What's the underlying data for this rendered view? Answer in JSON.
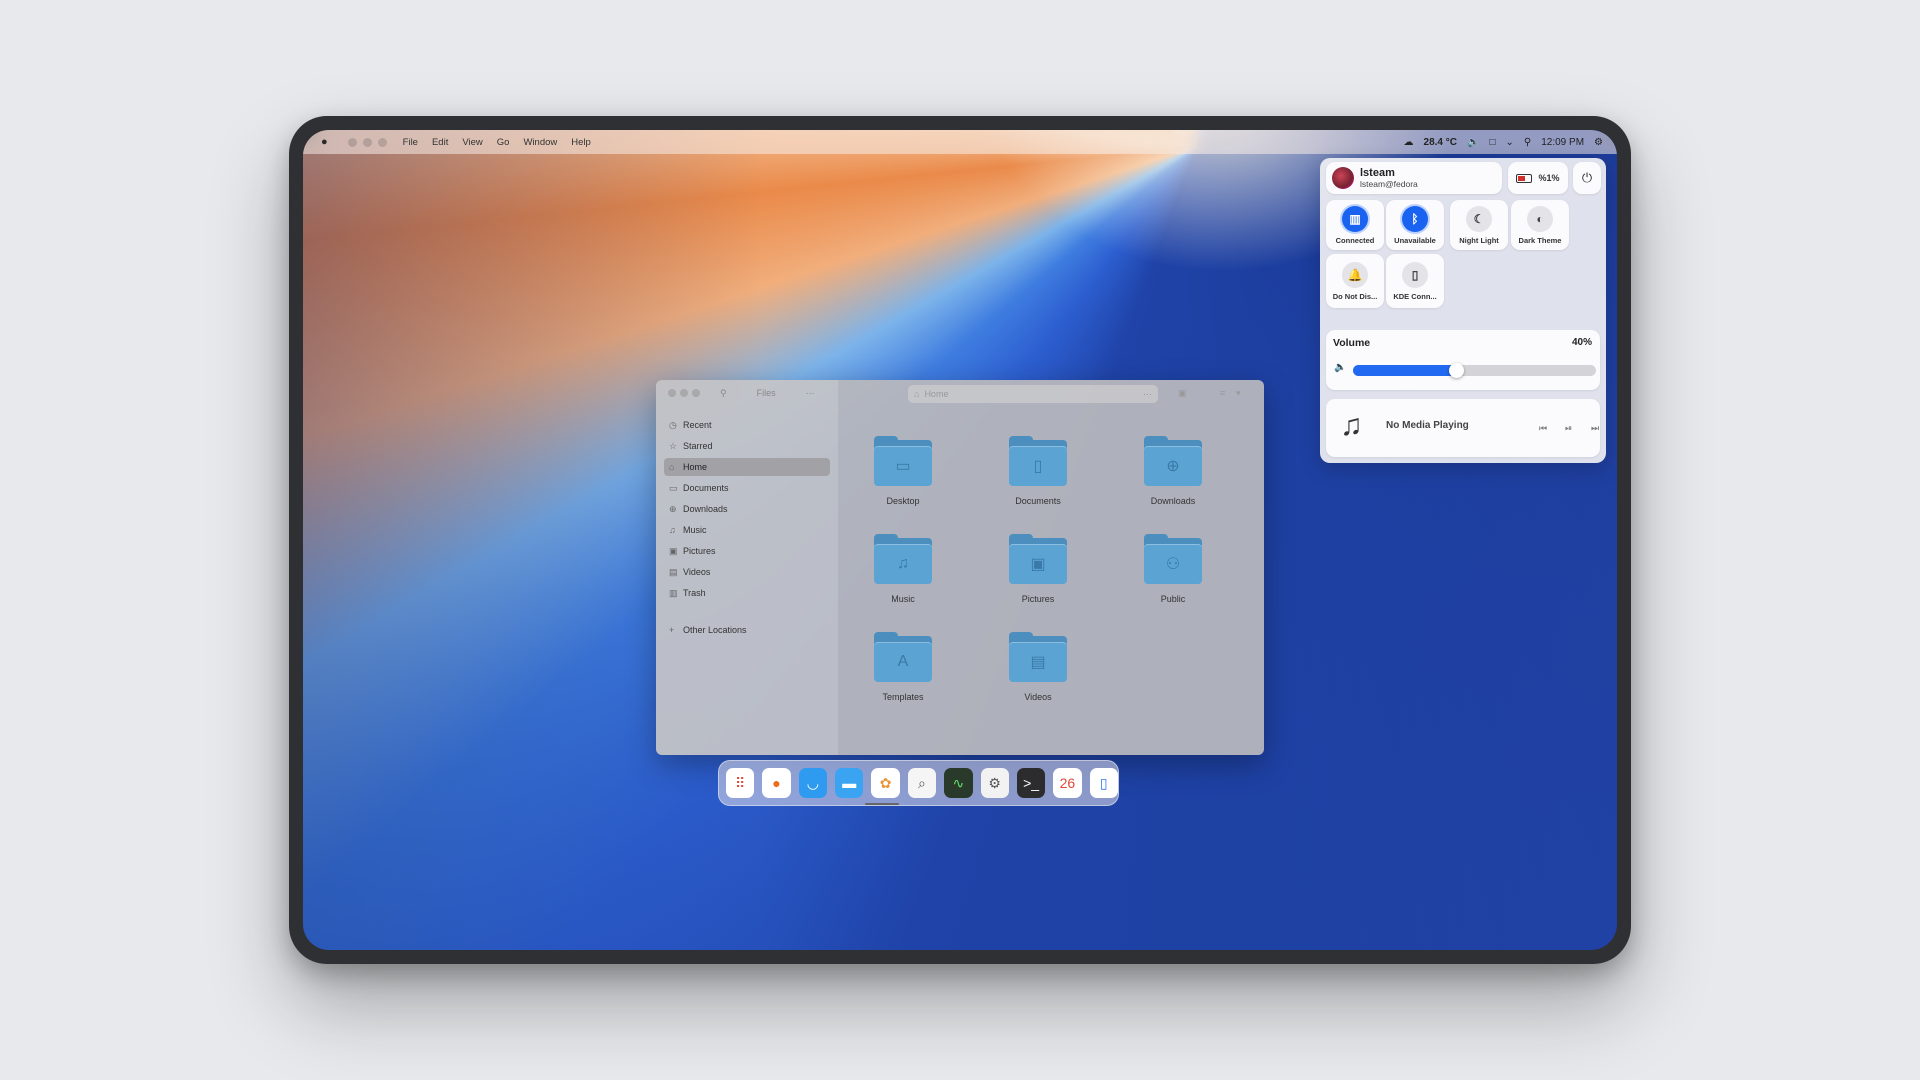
{
  "menubar": {
    "apple": "",
    "menus": [
      "File",
      "Edit",
      "View",
      "Go",
      "Window",
      "Help"
    ],
    "temperature": "28.4 °C",
    "time": "12:09 PM"
  },
  "control_center": {
    "user_name": "lsteam",
    "user_email": "lsteam@fedora",
    "battery": "%1%",
    "tiles": [
      {
        "label": "Connected",
        "icon": "network-icon",
        "glyph": "▥",
        "active": true
      },
      {
        "label": "Unavailable",
        "icon": "bluetooth-icon",
        "glyph": "ᛒ",
        "active": true
      },
      {
        "label": "Night Light",
        "icon": "night-light-icon",
        "glyph": "☾",
        "active": false
      },
      {
        "label": "Dark Theme",
        "icon": "dark-theme-icon",
        "glyph": "◐",
        "active": false
      },
      {
        "label": "Do Not Dis...",
        "icon": "bell-icon",
        "glyph": "🔔",
        "active": false
      },
      {
        "label": "KDE Conn...",
        "icon": "phone-icon",
        "glyph": "▯",
        "active": false
      }
    ],
    "volume": {
      "label": "Volume",
      "value_text": "40%",
      "level": 0.4
    },
    "media": {
      "text": "No Media Playing"
    }
  },
  "files": {
    "title": "Files",
    "path": "Home",
    "sidebar": [
      {
        "label": "Recent",
        "icon": "clock-icon",
        "glyph": "◷",
        "active": false
      },
      {
        "label": "Starred",
        "icon": "star-icon",
        "glyph": "☆",
        "active": false
      },
      {
        "label": "Home",
        "icon": "home-icon",
        "glyph": "⌂",
        "active": true
      },
      {
        "label": "Documents",
        "icon": "document-icon",
        "glyph": "▭",
        "active": false
      },
      {
        "label": "Downloads",
        "icon": "download-icon",
        "glyph": "⊕",
        "active": false
      },
      {
        "label": "Music",
        "icon": "music-icon",
        "glyph": "♫",
        "active": false
      },
      {
        "label": "Pictures",
        "icon": "picture-icon",
        "glyph": "▣",
        "active": false
      },
      {
        "label": "Videos",
        "icon": "video-icon",
        "glyph": "▤",
        "active": false
      },
      {
        "label": "Trash",
        "icon": "trash-icon",
        "glyph": "▥",
        "active": false
      }
    ],
    "other_locations": "Other Locations",
    "folders": [
      {
        "label": "Desktop",
        "glyph": "▭"
      },
      {
        "label": "Documents",
        "glyph": "▯"
      },
      {
        "label": "Downloads",
        "glyph": "⊕"
      },
      {
        "label": "Music",
        "glyph": "♫"
      },
      {
        "label": "Pictures",
        "glyph": "▣"
      },
      {
        "label": "Public",
        "glyph": "⚇"
      },
      {
        "label": "Templates",
        "glyph": "A"
      },
      {
        "label": "Videos",
        "glyph": "▤"
      }
    ]
  },
  "dock": {
    "apps": [
      {
        "name": "launcher-icon",
        "glyph": "⠿",
        "bg": "#ffffff",
        "fg": "#e0483a"
      },
      {
        "name": "firefox-icon",
        "glyph": "●",
        "bg": "#ffffff",
        "fg": "#f06a1b"
      },
      {
        "name": "app-store-icon",
        "glyph": "◡",
        "bg": "#2f9bf0",
        "fg": "#ffffff"
      },
      {
        "name": "files-icon",
        "glyph": "▬",
        "bg": "#3aa4f3",
        "fg": "#ffffff"
      },
      {
        "name": "photos-icon",
        "glyph": "✿",
        "bg": "#ffffff",
        "fg": "#e9953a"
      },
      {
        "name": "preview-icon",
        "glyph": "⌕",
        "bg": "#f5f5f5",
        "fg": "#555555"
      },
      {
        "name": "activity-monitor-icon",
        "glyph": "∿",
        "bg": "#2a3a2a",
        "fg": "#5fdf6a"
      },
      {
        "name": "settings-icon",
        "glyph": "⚙",
        "bg": "#f2f2f2",
        "fg": "#555555"
      },
      {
        "name": "terminal-icon",
        "glyph": ">_",
        "bg": "#2c2c2e",
        "fg": "#ffffff"
      },
      {
        "name": "calendar-icon",
        "glyph": "26",
        "bg": "#ffffff",
        "fg": "#e0483a"
      },
      {
        "name": "toggle-icon",
        "glyph": "▯",
        "bg": "#ffffff",
        "fg": "#2f7bf0"
      }
    ]
  }
}
